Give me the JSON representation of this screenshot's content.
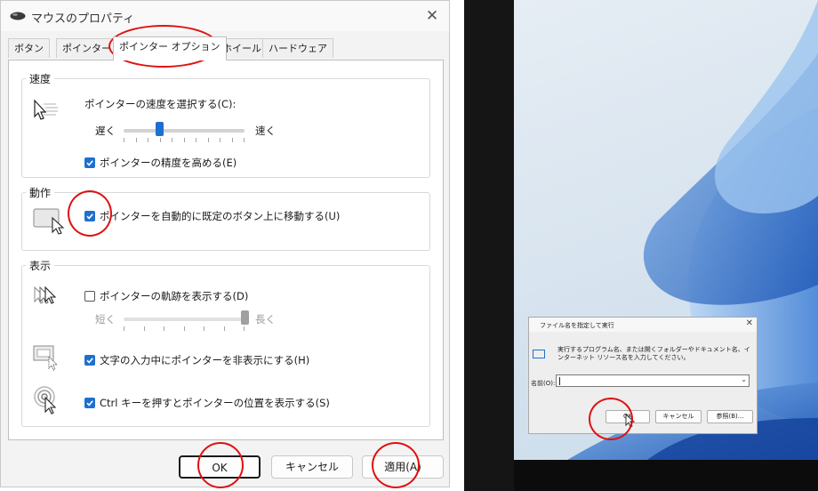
{
  "dialog": {
    "title": "マウスのプロパティ",
    "close_glyph": "✕",
    "tabs": [
      "ボタン",
      "ポインター",
      "ポインター オプション",
      "ホイール",
      "ハードウェア"
    ],
    "motion": {
      "title": "速度",
      "speed_label": "ポインターの速度を選択する(C):",
      "slow": "遅く",
      "fast": "速く",
      "speed_level": 0.3,
      "precision_label": "ポインターの精度を高める(E)",
      "precision_checked": true
    },
    "snap": {
      "title": "動作",
      "label": "ポインターを自動的に既定のボタン上に移動する(U)",
      "checked": true
    },
    "visibility": {
      "title": "表示",
      "trails_label": "ポインターの軌跡を表示する(D)",
      "trails_checked": false,
      "short": "短く",
      "long": "長く",
      "trail_level": 1.0,
      "hide_label": "文字の入力中にポインターを非表示にする(H)",
      "hide_checked": true,
      "ctrl_label": "Ctrl キーを押すとポインターの位置を表示する(S)",
      "ctrl_checked": true
    },
    "buttons": {
      "ok": "OK",
      "cancel": "キャンセル",
      "apply": "適用(A)"
    }
  },
  "run_dialog": {
    "title": "ファイル名を指定して実行",
    "close_glyph": "✕",
    "description": "実行するプログラム名、または開くフォルダーやドキュメント名、インターネット リソース名を入力してください。",
    "name_label": "名前(O):",
    "input_value": "",
    "dropdown_glyph": "⌄",
    "buttons": {
      "ok": "OK",
      "cancel": "キャンセル",
      "browse": "参照(B)..."
    }
  },
  "colors": {
    "accent": "#1f6fd0",
    "annotation": "#e01010"
  }
}
